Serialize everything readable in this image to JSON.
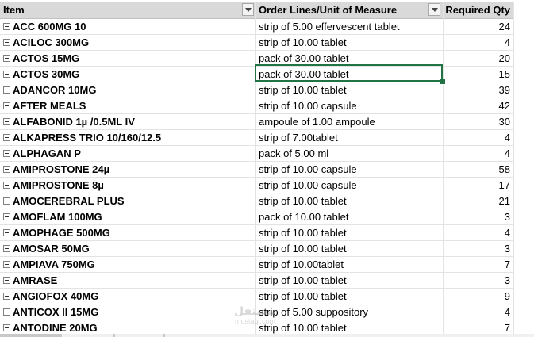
{
  "headers": {
    "item": "Item",
    "uom": "Order Lines/Unit of Measure",
    "qty": "Required Qty"
  },
  "rows": [
    {
      "item": "ACC 600MG 10",
      "uom": "strip of 5.00 effervescent tablet",
      "qty": "24"
    },
    {
      "item": "ACILOC 300MG",
      "uom": "strip of 10.00 tablet",
      "qty": "4"
    },
    {
      "item": "ACTOS 15MG",
      "uom": "pack of 30.00 tablet",
      "qty": "20"
    },
    {
      "item": "ACTOS 30MG",
      "uom": "pack of 30.00 tablet",
      "qty": "15"
    },
    {
      "item": "ADANCOR 10MG",
      "uom": "strip of 10.00 tablet",
      "qty": "39"
    },
    {
      "item": "AFTER MEALS",
      "uom": "strip of 10.00 capsule",
      "qty": "42"
    },
    {
      "item": "ALFABONID 1µ /0.5ML IV",
      "uom": "ampoule of 1.00 ampoule",
      "qty": "30"
    },
    {
      "item": "ALKAPRESS TRIO 10/160/12.5",
      "uom": "strip of 7.00tablet",
      "qty": "4"
    },
    {
      "item": "ALPHAGAN P",
      "uom": "pack of 5.00 ml",
      "qty": "4"
    },
    {
      "item": "AMIPROSTONE 24µ",
      "uom": "strip of 10.00 capsule",
      "qty": "58"
    },
    {
      "item": "AMIPROSTONE 8µ",
      "uom": "strip of 10.00 capsule",
      "qty": "17"
    },
    {
      "item": "AMOCEREBRAL PLUS",
      "uom": "strip of 10.00 tablet",
      "qty": "21"
    },
    {
      "item": "AMOFLAM 100MG",
      "uom": "pack of 10.00 tablet",
      "qty": "3"
    },
    {
      "item": "AMOPHAGE 500MG",
      "uom": "strip of 10.00 tablet",
      "qty": "4"
    },
    {
      "item": "AMOSAR 50MG",
      "uom": "strip of 10.00 tablet",
      "qty": "3"
    },
    {
      "item": "AMPIAVA 750MG",
      "uom": "strip of 10.00tablet",
      "qty": "7"
    },
    {
      "item": "AMRASE",
      "uom": "strip of 10.00 tablet",
      "qty": "3"
    },
    {
      "item": "ANGIOFOX 40MG",
      "uom": "strip of 10.00 tablet",
      "qty": "9"
    },
    {
      "item": "ANTICOX II 15MG",
      "uom": "strip of 5.00 suppository",
      "qty": "4"
    },
    {
      "item": "ANTODINE 20MG",
      "uom": "strip of 10.00 tablet",
      "qty": "7"
    }
  ],
  "selected_row": 3,
  "watermark": {
    "line1": "مستقل",
    "line2": "mostaql.com"
  },
  "colors": {
    "selection": "#217346",
    "header_bg": "#d9d9d9",
    "gridline": "#e3e3e3"
  },
  "icons": {
    "row_toggle": "minus-box-icon",
    "filter": "dropdown-arrow-icon"
  }
}
